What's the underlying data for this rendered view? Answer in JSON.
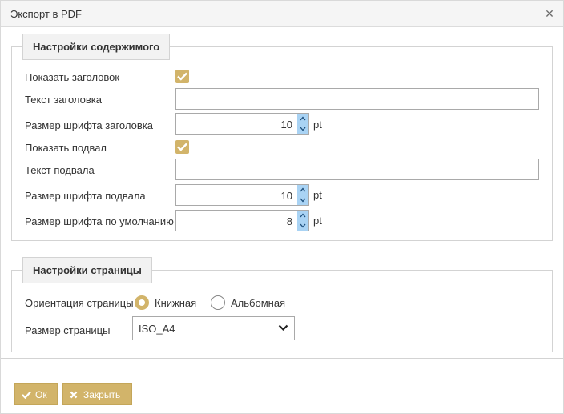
{
  "dialog": {
    "title": "Экспорт в PDF"
  },
  "content_settings": {
    "legend": "Настройки содержимого",
    "show_header_label": "Показать заголовок",
    "show_header_checked": true,
    "header_text_label": "Текст заголовка",
    "header_text_value": "",
    "header_font_size_label": "Размер шрифта заголовка",
    "header_font_size_value": "10",
    "show_footer_label": "Показать подвал",
    "show_footer_checked": true,
    "footer_text_label": "Текст подвала",
    "footer_text_value": "",
    "footer_font_size_label": "Размер шрифта подвала",
    "footer_font_size_value": "10",
    "default_font_size_label": "Размер шрифта по умолчанию",
    "default_font_size_value": "8",
    "unit": "pt"
  },
  "page_settings": {
    "legend": "Настройки страницы",
    "orientation_label": "Ориентация страницы",
    "orientation_portrait": "Книжная",
    "orientation_landscape": "Альбомная",
    "orientation_selected": "portrait",
    "page_size_label": "Размер страницы",
    "page_size_value": "ISO_A4"
  },
  "buttons": {
    "ok": "Ок",
    "close": "Закрыть"
  },
  "colors": {
    "accent": "#d2b46a",
    "spinner": "#a9d3f4"
  }
}
